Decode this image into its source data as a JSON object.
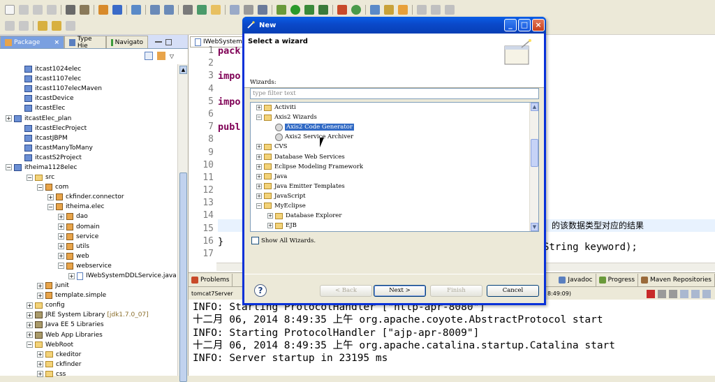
{
  "explorer": {
    "tabs": [
      "Package",
      "Type Hie",
      "Navigato"
    ],
    "items": [
      {
        "label": "itcast1024elec",
        "kind": "project",
        "indent": 1
      },
      {
        "label": "itcast1107elec",
        "kind": "project",
        "indent": 1
      },
      {
        "label": "itcast1107elecMaven",
        "kind": "project",
        "indent": 1
      },
      {
        "label": "itcastDevice",
        "kind": "project",
        "indent": 1
      },
      {
        "label": "itcastElec",
        "kind": "project",
        "indent": 1
      },
      {
        "label": "itcastElec_plan",
        "kind": "project",
        "indent": 0,
        "tw": "+"
      },
      {
        "label": "itcastElecProject",
        "kind": "project",
        "indent": 1
      },
      {
        "label": "itcastJBPM",
        "kind": "project",
        "indent": 1
      },
      {
        "label": "itcastManyToMany",
        "kind": "project",
        "indent": 1
      },
      {
        "label": "itcastS2Project",
        "kind": "project",
        "indent": 1
      },
      {
        "label": "itheima1128elec",
        "kind": "project",
        "indent": 0,
        "tw": "−"
      },
      {
        "label": "src",
        "kind": "folder",
        "indent": 2,
        "tw": "−"
      },
      {
        "label": "com",
        "kind": "package",
        "indent": 3,
        "tw": "−"
      },
      {
        "label": "ckfinder.connector",
        "kind": "package",
        "indent": 4,
        "tw": "+"
      },
      {
        "label": "itheima.elec",
        "kind": "package",
        "indent": 4,
        "tw": "−"
      },
      {
        "label": "dao",
        "kind": "package",
        "indent": 5,
        "tw": "+"
      },
      {
        "label": "domain",
        "kind": "package",
        "indent": 5,
        "tw": "+"
      },
      {
        "label": "service",
        "kind": "package",
        "indent": 5,
        "tw": "+"
      },
      {
        "label": "utils",
        "kind": "package",
        "indent": 5,
        "tw": "+"
      },
      {
        "label": "web",
        "kind": "package",
        "indent": 5,
        "tw": "+"
      },
      {
        "label": "webservice",
        "kind": "package",
        "indent": 5,
        "tw": "−"
      },
      {
        "label": "IWebSystemDDLService.java",
        "kind": "java",
        "indent": 6,
        "tw": "+"
      },
      {
        "label": "junit",
        "kind": "package",
        "indent": 3,
        "tw": "+"
      },
      {
        "label": "template.simple",
        "kind": "package",
        "indent": 3,
        "tw": "+"
      },
      {
        "label": "config",
        "kind": "folder",
        "indent": 2,
        "tw": "+"
      },
      {
        "label": "JRE System Library",
        "kind": "lib",
        "indent": 2,
        "tw": "+",
        "suffix": "[jdk1.7.0_07]"
      },
      {
        "label": "Java EE 5 Libraries",
        "kind": "lib",
        "indent": 2,
        "tw": "+"
      },
      {
        "label": "Web App Libraries",
        "kind": "lib",
        "indent": 2,
        "tw": "+"
      },
      {
        "label": "WebRoot",
        "kind": "folder",
        "indent": 2,
        "tw": "−"
      },
      {
        "label": "ckeditor",
        "kind": "folder",
        "indent": 3,
        "tw": "+"
      },
      {
        "label": "ckfinder",
        "kind": "folder",
        "indent": 3,
        "tw": "+"
      },
      {
        "label": "css",
        "kind": "folder",
        "indent": 3,
        "tw": "+"
      }
    ]
  },
  "editor": {
    "tab": "IWebSystemD",
    "line_numbers": [
      "1",
      "2",
      "3",
      "4",
      "5",
      "6",
      "7",
      "8",
      "9",
      "10",
      "11",
      "12",
      "13",
      "14",
      "15",
      "16",
      "17"
    ],
    "code_lines": [
      "pack",
      "",
      "impo",
      "",
      "impo",
      "",
      "publ",
      "",
      "",
      "",
      "",
      "",
      "",
      "",
      "",
      "}",
      ""
    ],
    "chinese_comment": "的该数据类型对应的结果",
    "method_sig": "String keyword);"
  },
  "console": {
    "tabs": [
      "Problems",
      "Javadoc",
      "Progress",
      "Maven Repositories"
    ],
    "server_label": "tomcat7Server",
    "time_label": "8:49:09)",
    "lines": [
      "INFO: Starting ProtocolHandler [\"http-apr-8080\"]",
      "十二月 06, 2014 8:49:35 上午 org.apache.coyote.AbstractProtocol start",
      "INFO: Starting ProtocolHandler [\"ajp-apr-8009\"]",
      "十二月 06, 2014 8:49:35 上午 org.apache.catalina.startup.Catalina start",
      "INFO: Server startup in 23195 ms"
    ]
  },
  "dialog": {
    "title": "New",
    "heading": "Select a wizard",
    "wizards_label": "Wizards:",
    "filter_placeholder": "type filter text",
    "items": [
      {
        "label": "Activiti",
        "indent": 0,
        "tw": "+",
        "icon": "folder"
      },
      {
        "label": "Axis2 Wizards",
        "indent": 0,
        "tw": "−",
        "icon": "folder"
      },
      {
        "label": "Axis2 Code Generator",
        "indent": 1,
        "tw": "",
        "icon": "wizard",
        "selected": true
      },
      {
        "label": "Axis2 Service Archiver",
        "indent": 1,
        "tw": "",
        "icon": "wizard"
      },
      {
        "label": "CVS",
        "indent": 0,
        "tw": "+",
        "icon": "folder"
      },
      {
        "label": "Database Web Services",
        "indent": 0,
        "tw": "+",
        "icon": "folder"
      },
      {
        "label": "Eclipse Modeling Framework",
        "indent": 0,
        "tw": "+",
        "icon": "folder"
      },
      {
        "label": "Java",
        "indent": 0,
        "tw": "+",
        "icon": "folder"
      },
      {
        "label": "Java Emitter Templates",
        "indent": 0,
        "tw": "+",
        "icon": "folder"
      },
      {
        "label": "JavaScript",
        "indent": 0,
        "tw": "+",
        "icon": "folder"
      },
      {
        "label": "MyEclipse",
        "indent": 0,
        "tw": "−",
        "icon": "folder"
      },
      {
        "label": "Database Explorer",
        "indent": 1,
        "tw": "+",
        "icon": "folder"
      },
      {
        "label": "EJB",
        "indent": 1,
        "tw": "+",
        "icon": "folder"
      }
    ],
    "show_all_label": "Show All Wizards.",
    "buttons": {
      "back": "< Back",
      "next": "Next >",
      "finish": "Finish",
      "cancel": "Cancel"
    }
  }
}
